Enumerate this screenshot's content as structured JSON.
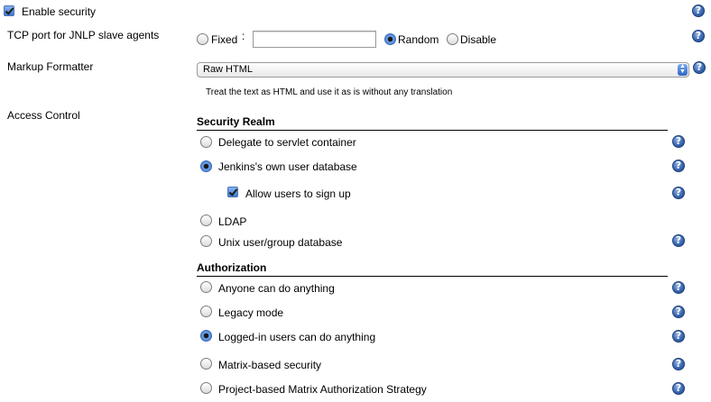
{
  "enable_security": {
    "label": "Enable security",
    "checked": true
  },
  "tcp_port": {
    "label": "TCP port for JNLP slave agents",
    "options": [
      "Fixed",
      "Random",
      "Disable"
    ],
    "selected": "Random",
    "colon": ":",
    "fixed_value": ""
  },
  "markup_formatter": {
    "label": "Markup Formatter",
    "selected": "Raw HTML",
    "description": "Treat the text as HTML and use it as is without any translation"
  },
  "access_control": {
    "label": "Access Control",
    "security_realm": {
      "heading": "Security Realm",
      "options": [
        "Delegate to servlet container",
        "Jenkins's own user database",
        "LDAP",
        "Unix user/group database"
      ],
      "selected": "Jenkins's own user database",
      "allow_signup": {
        "label": "Allow users to sign up",
        "checked": true
      }
    },
    "authorization": {
      "heading": "Authorization",
      "options": [
        "Anyone can do anything",
        "Legacy mode",
        "Logged-in users can do anything",
        "Matrix-based security",
        "Project-based Matrix Authorization Strategy"
      ],
      "selected": "Logged-in users can do anything"
    }
  },
  "icons": {
    "help": "help-icon",
    "dropdown": "chevron-updown-icon"
  },
  "colors": {
    "help_blue": "#3a67b0",
    "selected_radio": "#3d78d0"
  }
}
